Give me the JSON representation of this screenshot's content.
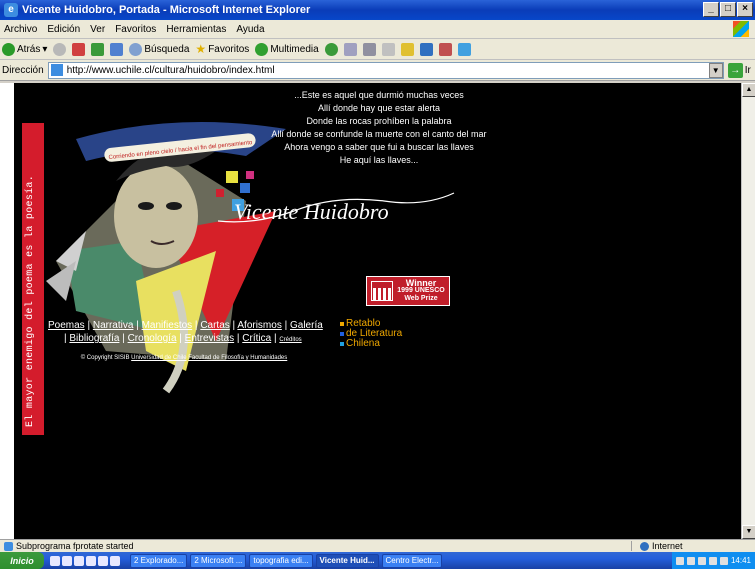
{
  "window": {
    "title": "Vicente Huidobro, Portada - Microsoft Internet Explorer"
  },
  "menu": [
    "Archivo",
    "Edición",
    "Ver",
    "Favoritos",
    "Herramientas",
    "Ayuda"
  ],
  "toolbar": {
    "back": "Atrás",
    "search": "Búsqueda",
    "favorites": "Favoritos",
    "multimedia": "Multimedia"
  },
  "address": {
    "label": "Dirección",
    "url": "http://www.uchile.cl/cultura/huidobro/index.html",
    "go": "Ir"
  },
  "page": {
    "vertical_banner": "El mayor enemigo del poema es la poesía.",
    "speech_bubble": "Corriendo en pleno cielo / hacia el fin del pensamiento",
    "poem": [
      "...Este es aquel que durmió muchas veces",
      "Allí donde hay que estar alerta",
      "Donde las rocas prohíben la palabra",
      "Allí donde se confunde la muerte con el canto del mar",
      "Ahora vengo a saber que fui a buscar las llaves",
      "He aquí las llaves..."
    ],
    "signature": "Vicente Huidobro",
    "unesco": {
      "winner": "Winner",
      "year": "1999 UNESCO",
      "prize": "Web Prize"
    },
    "nav_row1": [
      "Poemas",
      "Narrativa",
      "Manifiestos",
      "Cartas",
      "Aforismos",
      "Galería"
    ],
    "nav_row2": [
      "Bibliografía",
      "Cronología",
      "Entrevistas",
      "Crítica"
    ],
    "credits": "Créditos",
    "copyright_text": "© Copyright SISIB",
    "copyright_link1": "Universidad de Chile",
    "copyright_link2": "Facultad de Filosofía y Humanidades",
    "retablo": [
      "Retablo",
      "de Literatura",
      "Chilena"
    ],
    "retablo_colors": [
      "#f0a800",
      "#2060e0",
      "#20a0e0"
    ]
  },
  "status": {
    "message": "Subprograma fprotate started",
    "zone": "Internet"
  },
  "taskbar": {
    "start": "Inicio",
    "tasks": [
      "2 Explorado...",
      "2 Microsoft ...",
      "topografia edi...",
      "Vicente Huid...",
      "Centro Electr..."
    ],
    "clock": "14:41"
  }
}
